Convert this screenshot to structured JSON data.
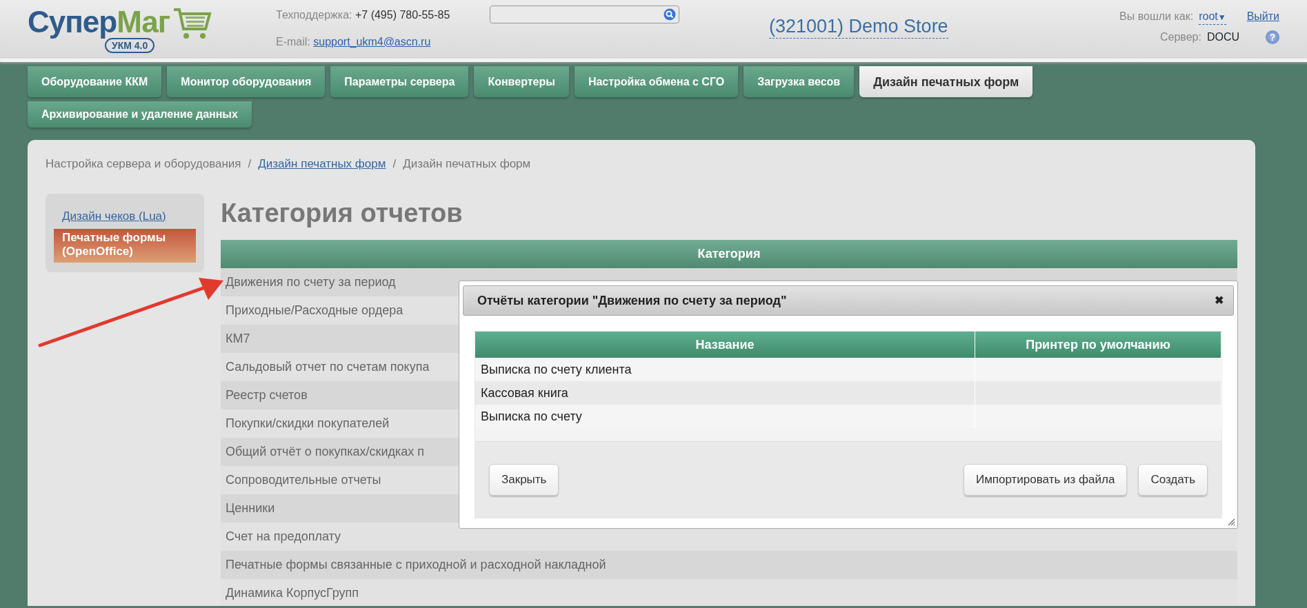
{
  "header": {
    "logo": {
      "part1": "Супер",
      "part2": "Маг",
      "badge": "УКМ 4.0"
    },
    "support": {
      "label": "Техподдержка:",
      "phone": "+7 (495) 780-55-85"
    },
    "email": {
      "label": "E-mail:",
      "address": "support_ukm4@ascn.ru"
    },
    "store": "(321001) Demo Store",
    "user": {
      "label": "Вы вошли как:",
      "name": "root",
      "caret": "▼",
      "logout": "Выйти"
    },
    "server": {
      "label": "Сервер:",
      "name": "DOCU"
    },
    "help": "?"
  },
  "tabs": [
    {
      "label": "Оборудование ККМ",
      "selected": false
    },
    {
      "label": "Монитор оборудования",
      "selected": false
    },
    {
      "label": "Параметры сервера",
      "selected": false
    },
    {
      "label": "Конвертеры",
      "selected": false
    },
    {
      "label": "Настройка обмена с СГО",
      "selected": false
    },
    {
      "label": "Загрузка весов",
      "selected": false
    },
    {
      "label": "Дизайн печатных форм",
      "selected": true
    },
    {
      "label": "Архивирование и удаление данных",
      "selected": false
    }
  ],
  "breadcrumb": [
    {
      "text": "Настройка сервера и оборудования",
      "kind": "text"
    },
    {
      "text": "Дизайн печатных форм",
      "kind": "link"
    },
    {
      "text": "Дизайн печатных форм",
      "kind": "text"
    }
  ],
  "breadcrumb_separator": "/",
  "sidebar": {
    "items": [
      {
        "label": "Дизайн чеков (Lua)",
        "selected": false
      },
      {
        "label": "Печатные формы (OpenOffice)",
        "selected": true
      }
    ]
  },
  "title": "Категория отчетов",
  "table": {
    "columns": [
      "Категория"
    ],
    "rows": [
      "Движения по счету за период",
      "Приходные/Расходные ордера",
      "КМ7",
      "Сальдовый отчет по счетам покупа",
      "Реестр счетов",
      "Покупки/скидки покупателей",
      "Общий отчёт о покупках/скидках п",
      "Сопроводительные отчеты",
      "Ценники",
      "Счет на предоплату",
      "Печатные формы связанные с приходной и расходной накладной",
      "Динамика КорпусГрупп"
    ]
  },
  "dialog": {
    "title": "Отчёты категории \"Движения по счету за период\"",
    "close": "✖",
    "columns": [
      "Название",
      "Принтер по умолчанию"
    ],
    "rows": [
      {
        "name": "Выписка по счету клиента"
      },
      {
        "name": "Кассовая книга"
      },
      {
        "name": "Выписка по счету"
      }
    ],
    "buttons_left": [
      "Закрыть"
    ],
    "buttons_right": [
      "Импортировать из файла",
      "Создать"
    ]
  },
  "annotations": [
    {
      "kind": "arrow"
    }
  ]
}
